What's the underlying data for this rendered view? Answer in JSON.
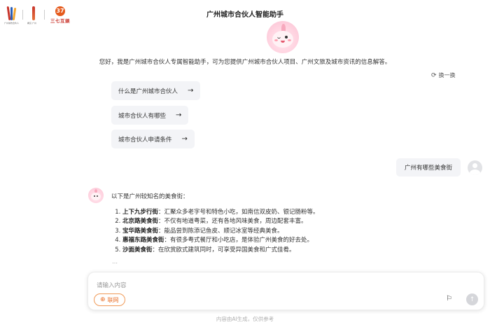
{
  "header": {
    "title": "广州城市合伙人智能助手",
    "logos": {
      "logo1_caption": "广州城市合伙人",
      "logo2_caption": "看见·广州",
      "logo3_text": "三七互娱",
      "logo3_mark": "37"
    }
  },
  "welcome": {
    "greeting": "您好，我是广州城市合伙人专属智能助手，可为您提供广州城市合伙人项目、广州文旅及城市资讯的信息解答。",
    "refresh_label": "换一换",
    "suggestions": [
      {
        "label": "什么是广州城市合伙人"
      },
      {
        "label": "城市合伙人有哪些"
      },
      {
        "label": "城市合伙人申请条件"
      }
    ]
  },
  "conversation": {
    "user_message": "广州有哪些美食街",
    "answer_intro": "以下是广州较知名的美食街：",
    "answer_items": [
      {
        "name": "上下九步行街",
        "desc": "：汇聚众多老字号和特色小吃，如南信双皮奶、银记肠粉等。"
      },
      {
        "name": "北京路美食街",
        "desc": "：不仅有地道粤菜，还有各地风味美食，周边配套丰富。"
      },
      {
        "name": "宝华路美食街",
        "desc": "：能品尝到陈添记鱼皮、顺记冰室等经典美食。"
      },
      {
        "name": "惠福东路美食街",
        "desc": "：有很多粤式餐厅和小吃店，是体验广州美食的好去处。"
      },
      {
        "name": "沙面美食街",
        "desc": "：在欣赏欧式建筑同时，可享受异国美食和广式佳肴。"
      }
    ]
  },
  "composer": {
    "placeholder": "请输入内容",
    "web_toggle_label": "联网"
  },
  "footer": {
    "disclaimer": "内容由AI生成，仅供参考"
  },
  "colors": {
    "accent_orange": "#e8702a",
    "bubble_bg": "#f3f4f7"
  }
}
